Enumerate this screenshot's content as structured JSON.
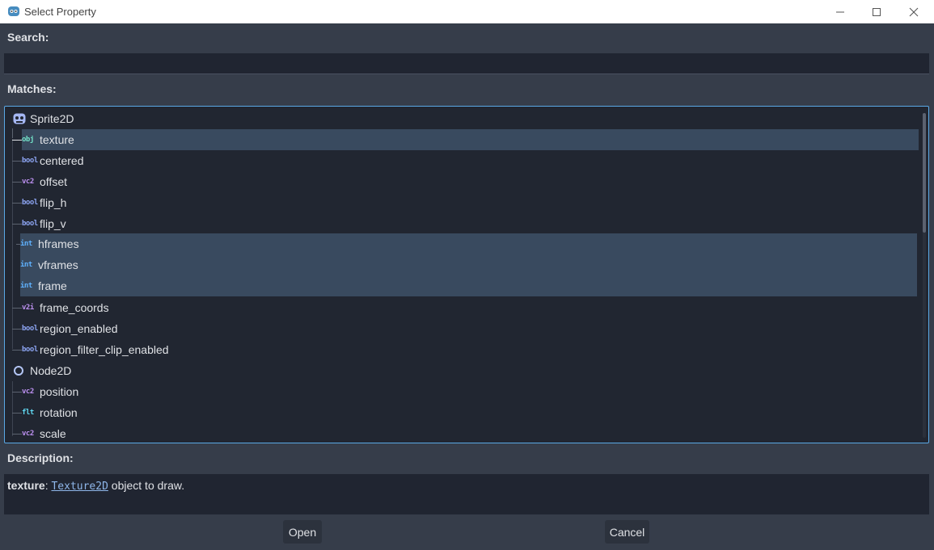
{
  "window": {
    "title": "Select Property"
  },
  "search": {
    "label": "Search:",
    "value": ""
  },
  "matches": {
    "label": "Matches:"
  },
  "tree": {
    "root1": {
      "label": "Sprite2D",
      "icon": "sprite2d-icon",
      "color": "#a5b7f3"
    },
    "items1": [
      {
        "badge": "obj",
        "label": "texture",
        "badge_color": "#72e1c7"
      },
      {
        "badge": "bool",
        "label": "centered",
        "badge_color": "#8da5f3"
      },
      {
        "badge": "vc2",
        "label": "offset",
        "badge_color": "#bd91f1"
      },
      {
        "badge": "bool",
        "label": "flip_h",
        "badge_color": "#8da5f3"
      },
      {
        "badge": "bool",
        "label": "flip_v",
        "badge_color": "#8da5f3"
      },
      {
        "badge": "int",
        "label": "hframes",
        "badge_color": "#5fb2ff"
      },
      {
        "badge": "int",
        "label": "vframes",
        "badge_color": "#5fb2ff"
      },
      {
        "badge": "int",
        "label": "frame",
        "badge_color": "#5fb2ff"
      },
      {
        "badge": "v2i",
        "label": "frame_coords",
        "badge_color": "#bd91f1"
      },
      {
        "badge": "bool",
        "label": "region_enabled",
        "badge_color": "#8da5f3"
      },
      {
        "badge": "bool",
        "label": "region_filter_clip_enabled",
        "badge_color": "#8da5f3"
      }
    ],
    "root2": {
      "label": "Node2D",
      "icon": "node2d-icon",
      "color": "#b4c6f5"
    },
    "items2": [
      {
        "badge": "vc2",
        "label": "position",
        "badge_color": "#bd91f1"
      },
      {
        "badge": "flt",
        "label": "rotation",
        "badge_color": "#61daf4"
      },
      {
        "badge": "vc2",
        "label": "scale",
        "badge_color": "#bd91f1"
      }
    ]
  },
  "description": {
    "label": "Description:",
    "prop": "texture",
    "sep": ": ",
    "link": "Texture2D",
    "rest": " object to draw."
  },
  "buttons": {
    "open": "Open",
    "cancel": "Cancel"
  },
  "colors": {
    "accent": "#5aa9e6",
    "selection": "#394a5f",
    "background": "#363d4a"
  }
}
